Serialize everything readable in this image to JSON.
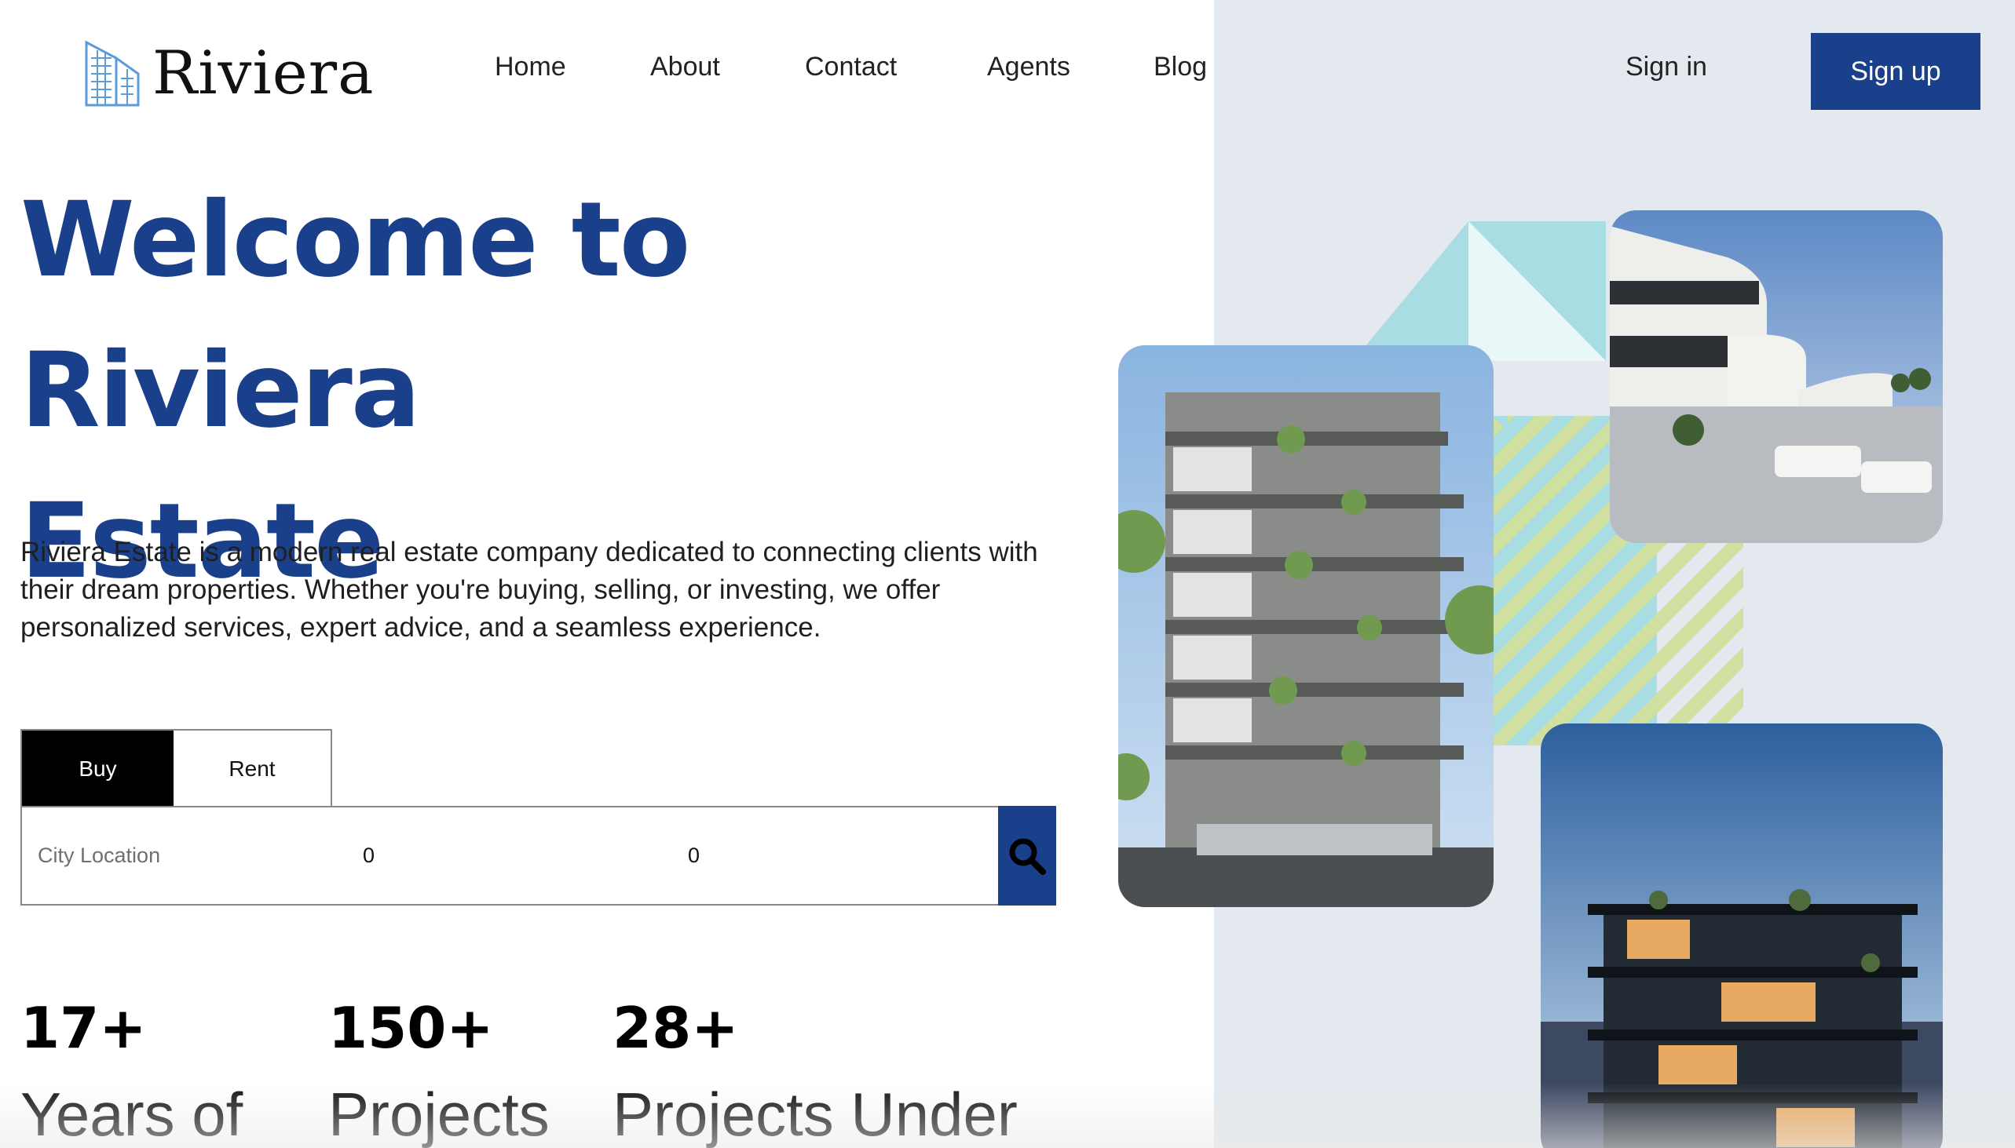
{
  "brand": {
    "name": "Riviera",
    "primary_color": "#1a3f8b",
    "logo_icon": "building-icon"
  },
  "nav": {
    "items": [
      "Home",
      "About",
      "Contact",
      "Agents",
      "Blog"
    ],
    "signin_label": "Sign in",
    "signup_label": "Sign up"
  },
  "hero": {
    "title_line1": "Welcome to Riviera",
    "title_line2": "Estate",
    "description": "Riviera Estate is a modern real estate company dedicated to connecting clients with their dream properties. Whether you're buying, selling, or investing, we offer personalized services, expert advice, and a seamless experience."
  },
  "search": {
    "tabs": [
      "Buy",
      "Rent"
    ],
    "active_tab": "Buy",
    "city_placeholder": "City Location",
    "min_value": "0",
    "max_value": "0",
    "button_icon": "search-icon"
  },
  "stats": [
    {
      "number": "17+",
      "label": "Years of"
    },
    {
      "number": "150+",
      "label": "Projects"
    },
    {
      "number": "28+",
      "label": "Projects Under"
    }
  ]
}
